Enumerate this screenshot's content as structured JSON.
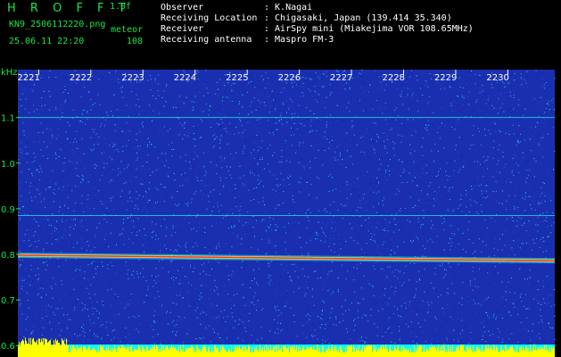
{
  "header": {
    "app_name": "H R O F F T",
    "version": "1.0f",
    "filename": "KN9_2506112220.png",
    "timestamp": "25.06.11 22:20",
    "meteor_label": "meteor",
    "meteor_count": "108",
    "info": [
      {
        "label": "Observer",
        "value": ": K.Nagai"
      },
      {
        "label": "Receiving Location",
        "value": ": Chigasaki, Japan (139.414 35.340)"
      },
      {
        "label": "Receiver",
        "value": ": AirSpy mini (Miakejima VOR 108.65MHz)"
      },
      {
        "label": "Receiving antenna",
        "value": ": Maspro FM-3"
      }
    ]
  },
  "chart_data": {
    "type": "heatmap",
    "ylabel": "kHz",
    "y_ticks": [
      "1.1",
      "1.0",
      "0.9",
      "0.8",
      "0.7",
      "0.6"
    ],
    "y_tick_values": [
      1.1,
      1.0,
      0.9,
      0.8,
      0.7,
      0.6
    ],
    "ylim": [
      0.575,
      1.205
    ],
    "x_ticks": [
      "2221",
      "2222",
      "2223",
      "2224",
      "2225",
      "2226",
      "2227",
      "2228",
      "2229",
      "2230"
    ],
    "x_tick_values": [
      1,
      2,
      3,
      4,
      5,
      6,
      7,
      8,
      9,
      10
    ],
    "xlim": [
      0.6,
      10.9
    ],
    "x_unit_note": "",
    "horizontal_lines_khz": [
      1.1,
      0.885
    ],
    "carrier_line": {
      "start_khz": 0.798,
      "end_khz": 0.786
    },
    "colors": {
      "background": "#1a2fb0",
      "noise_light": "#3aa6ff",
      "noise_cyan": "#24e8e0",
      "carrier": "#ff3030",
      "carrier_glow": "#f4ff40",
      "bottom_bar": "#ffff00",
      "bottom_bar_alt": "#00ffff",
      "text_green": "#19e64a",
      "text_white": "#ffffff"
    }
  }
}
